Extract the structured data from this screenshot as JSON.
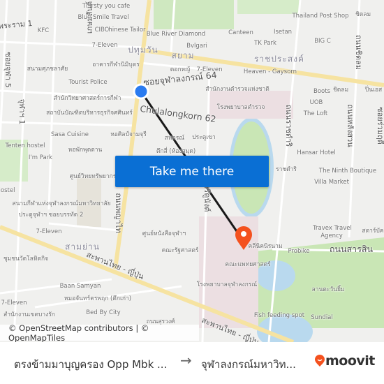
{
  "map": {
    "labels": [
      "Thirsty you cafe",
      "Blue Smile Travel",
      "CIBO",
      "Chinese Tailor",
      "KFC",
      "Blue River Diamond",
      "Canteen",
      "Isetan",
      "TK Park",
      "BIG C",
      "Thailand Post Shop",
      "ชิดลม",
      "7-Eleven",
      "Bvlgari",
      "7-Eleven",
      "Heaven - Gaysorn",
      "สนามศุภชลาศัย",
      "อาคารกีฬานิมิบุตร",
      "ดอกหญ้",
      "Tourist Police",
      "สำนักงานตำรวจแห่งชาติ",
      "Boots",
      "UOB",
      "The Loft",
      "ชิดลม",
      "ปิ่นเอส",
      "สำนักวิทยาศาสตร์การกีฬา",
      "โรงพยาบาลตำรวจ",
      "สถาบันบัณฑิตบริหารธุรกิจศศินทร์",
      "Sasa Cuisine",
      "หอศิลป์จามจุรี",
      "สหกรณ์",
      "ประตูเขา",
      "หอพักพุดตาน",
      "ตึกสี่ (ห้องสมุด)",
      "Tenten hostel",
      "I'm Park",
      "Hansar Hotel",
      "ราชดำริ",
      "The Ninth Boutique",
      "Villa Market",
      "ศูนย์วิทยทรัพยากร",
      "สนามกีฬาแห่งจุฬาลงกรณ์มหาวิทยาลัย",
      "ประตูจุฬาฯ ซอยบรรทัด 2",
      "7-Eleven",
      "ศูนย์หนังสือจุฬาฯ",
      "คณะรัฐศาสตร์",
      "ชุมชนวัดโลหิตกิจ",
      "Baan Samyan",
      "หมอจันทร์ครพฤก (ตึกเก่า)",
      "Bed By City",
      "Travex Travel",
      "Agency",
      "สตาร์บัค",
      "คลีนิคนิรนาม",
      "Probike",
      "คณะแพทยศาสตร์",
      "โรงพยาบาลจุฬาลงกรณ์",
      "ลานตะวันยิ้ม",
      "Fish feeding spot",
      "Sundial",
      "7-Eleven",
      "สำนักงานเขตบางรัก",
      "Hostel",
      "ถนนสุรวงศ์"
    ],
    "districts": [
      "ปทุมวัน",
      "สยาม",
      "ราชประสงค์",
      "สามย่าน"
    ],
    "roads": [
      "ซอยจุฬาลงกรณ์ 64",
      "Chulalongkorn 62",
      "ถนนสารสิน",
      "สะพานไทย - ญี่ปุ่น",
      "สะพานไทย - ญี่ปุ่น",
      "ถนนพญาไท",
      "ถนนอังรีดูนังต์",
      "ถนนราชดำริ",
      "ถนนหลังสวน",
      "ถนนชิดลม",
      "ซอยร่วมฤดี",
      "ซอยจุฬา 5",
      "จุฬาฯ 1",
      "เกษมสันต์",
      "พระราม 1"
    ],
    "origin_marker_color": "#2a7bf0",
    "destination_marker_color": "#f4511e",
    "route_color": "#1a1a1a"
  },
  "cta": {
    "label": "Take me there",
    "color": "#0a6fd4"
  },
  "attribution": "© OpenStreetMap contributors | © OpenMapTiles",
  "footer": {
    "from": "ตรงข้ามมาบุญครอง Opp Mbk ...",
    "arrow_icon": "arrow-right-icon",
    "to": "จุฬาลงกรณ์มหาวิท...",
    "brand": "moovit",
    "brand_color": "#f4511e"
  }
}
